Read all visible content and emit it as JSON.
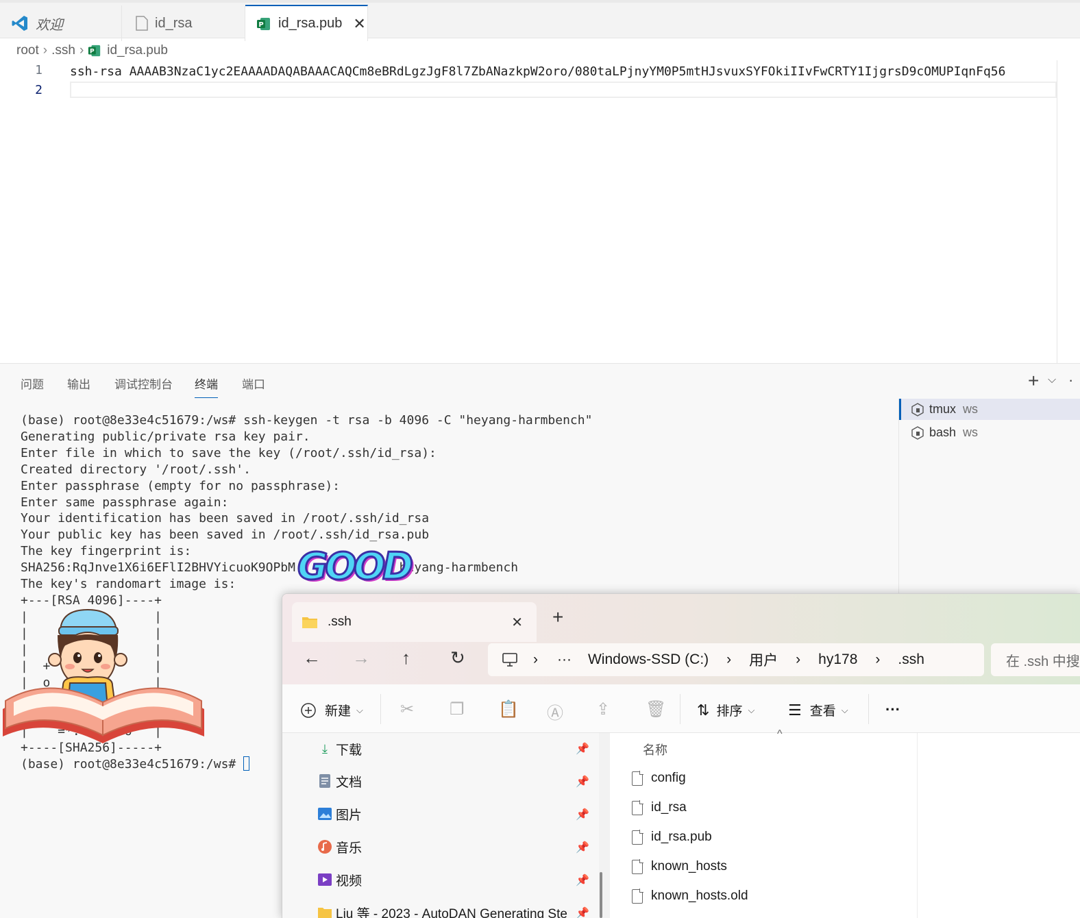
{
  "tabs": [
    {
      "label": "欢迎",
      "icon": "vscode-logo-icon"
    },
    {
      "label": "id_rsa",
      "icon": "file-icon"
    },
    {
      "label": "id_rsa.pub",
      "icon": "publisher-file-icon",
      "close": "✕"
    }
  ],
  "breadcrumb": [
    "root",
    ".ssh",
    "id_rsa.pub"
  ],
  "editor": {
    "line_numbers": [
      "1",
      "2"
    ],
    "line1": "ssh-rsa AAAAB3NzaC1yc2EAAAADAQABAAACAQCm8eBRdLgzJgF8l7ZbANazkpW2oro/080taLPjnyYM0P5mtHJsvuxSYFOkiIIvFwCRTY1IjgrsD9cOMUPIqnFq56"
  },
  "panel": {
    "tabs": [
      "问题",
      "输出",
      "调试控制台",
      "终端",
      "端口"
    ],
    "active_tab": "终端",
    "actions": {
      "add": "+",
      "dropdown": "⌵",
      "more": "·"
    },
    "terminal_lines": [
      "(base) root@8e33e4c51679:/ws# ssh-keygen -t rsa -b 4096 -C \"heyang-harmbench\"",
      "Generating public/private rsa key pair.",
      "Enter file in which to save the key (/root/.ssh/id_rsa):",
      "Created directory '/root/.ssh'.",
      "Enter passphrase (empty for no passphrase):",
      "Enter same passphrase again:",
      "Your identification has been saved in /root/.ssh/id_rsa",
      "Your public key has been saved in /root/.ssh/id_rsa.pub",
      "The key fingerprint is:",
      "SHA256:RqJnve1X6i6EFlI2BHVYicuoK9OPbM            A heyang-harmbench",
      "The key's randomart image is:",
      "+---[RSA 4096]----+",
      "|                 |",
      "|                 |",
      "|                 |",
      "|  +              |",
      "|  o              |",
      "|                 |",
      "|                 |",
      "|    =*.    .=o   |",
      "+----[SHA256]-----+",
      "(base) root@8e33e4c51679:/ws# "
    ],
    "sessions": [
      {
        "name": "tmux",
        "cwd": "ws"
      },
      {
        "name": "bash",
        "cwd": "ws"
      }
    ]
  },
  "sticker": {
    "text": "GOOD"
  },
  "explorer": {
    "tab_title": ".ssh",
    "tab_close": "✕",
    "new_tab": "+",
    "address": [
      ".ssh",
      "Windows-SSD (C:)",
      "用户",
      "hy178",
      ".ssh"
    ],
    "address_more": "···",
    "search_placeholder": "在 .ssh 中搜",
    "commands": {
      "new": "新建",
      "sort": "排序",
      "view": "查看",
      "more": "···"
    },
    "sidebar": [
      {
        "label": "下载",
        "icon": "download-icon"
      },
      {
        "label": "文档",
        "icon": "documents-icon"
      },
      {
        "label": "图片",
        "icon": "pictures-icon"
      },
      {
        "label": "音乐",
        "icon": "music-icon"
      },
      {
        "label": "视频",
        "icon": "videos-icon"
      },
      {
        "label": "Liu 等 - 2023 - AutoDAN Generating Ste",
        "icon": "folder-icon"
      }
    ],
    "column_header": "名称",
    "files": [
      "config",
      "id_rsa",
      "id_rsa.pub",
      "known_hosts",
      "known_hosts.old"
    ]
  }
}
